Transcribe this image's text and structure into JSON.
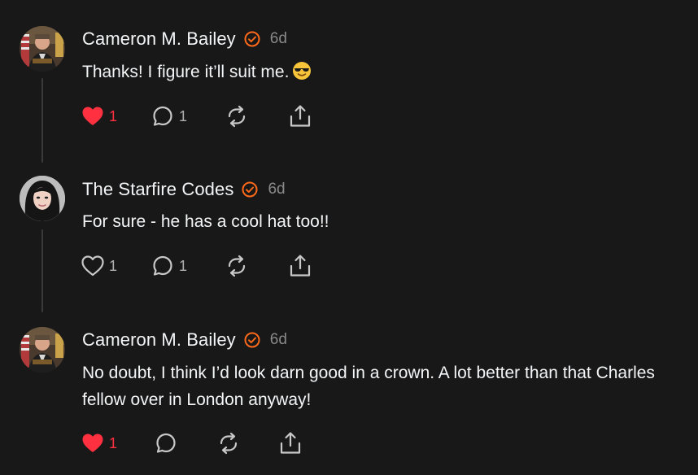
{
  "posts": [
    {
      "author": "Cameron M. Bailey",
      "time": "6d",
      "text": "Thanks! I figure it’ll suit me.",
      "emoji": "sunglasses-emoji",
      "liked": true,
      "likes": "1",
      "replies": "1",
      "avatar": "avatar-cameron"
    },
    {
      "author": "The Starfire Codes",
      "time": "6d",
      "text": "For sure - he has a cool hat too!!",
      "liked": false,
      "likes": "1",
      "replies": "1",
      "avatar": "avatar-starfire"
    },
    {
      "author": "Cameron M. Bailey",
      "time": "6d",
      "text": "No doubt, I think I’d look darn good in a crown. A lot better than that Charles fellow over in London anyway!",
      "liked": true,
      "likes": "1",
      "replies": "",
      "avatar": "avatar-cameron"
    }
  ],
  "colors": {
    "background": "#181818",
    "verified": "#ff6a1a",
    "liked": "#ff3040",
    "muted": "#8a8a8a"
  },
  "icons": [
    "heart-icon",
    "comment-icon",
    "repost-icon",
    "share-icon",
    "verified-badge-icon"
  ]
}
